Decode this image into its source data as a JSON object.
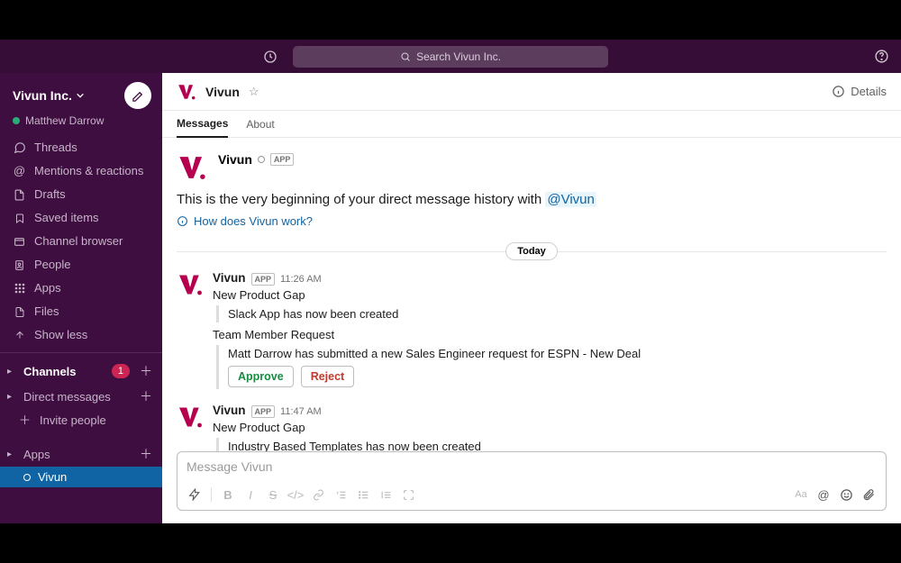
{
  "topbar": {
    "search_placeholder": "Search Vivun Inc."
  },
  "workspace": {
    "name": "Vivun Inc.",
    "user_presence": "active",
    "user_name": "Matthew Darrow"
  },
  "sidebar": {
    "nav": [
      {
        "icon": "threads",
        "label": "Threads"
      },
      {
        "icon": "mentions",
        "label": "Mentions & reactions"
      },
      {
        "icon": "drafts",
        "label": "Drafts"
      },
      {
        "icon": "bookmark",
        "label": "Saved items"
      },
      {
        "icon": "browser",
        "label": "Channel browser"
      },
      {
        "icon": "people",
        "label": "People"
      },
      {
        "icon": "apps",
        "label": "Apps"
      },
      {
        "icon": "files",
        "label": "Files"
      },
      {
        "icon": "up",
        "label": "Show less"
      }
    ],
    "channels_label": "Channels",
    "channels_badge": "1",
    "dm_label": "Direct messages",
    "invite_label": "Invite people",
    "apps_label": "Apps",
    "apps_items": [
      {
        "label": "Vivun",
        "selected": true
      }
    ]
  },
  "header": {
    "title": "Vivun",
    "details_label": "Details",
    "tabs": [
      {
        "label": "Messages",
        "active": true
      },
      {
        "label": "About",
        "active": false
      }
    ]
  },
  "intro": {
    "name": "Vivun",
    "beginning_text": "This is the very beginning of your direct message history with ",
    "mention": "@Vivun",
    "how_link": "How does Vivun work?"
  },
  "day_separator": "Today",
  "messages": [
    {
      "name": "Vivun",
      "time": "11:26 AM",
      "title": "New Product Gap",
      "block": "Slack App has now been created",
      "title2": "Team Member Request",
      "block2": "Matt Darrow has submitted a new Sales Engineer request for ESPN - New Deal",
      "approve": "Approve",
      "reject": "Reject"
    },
    {
      "name": "Vivun",
      "time": "11:47 AM",
      "title": "New Product Gap",
      "block": "Industry Based Templates has now been created"
    }
  ],
  "composer": {
    "placeholder": "Message Vivun"
  }
}
